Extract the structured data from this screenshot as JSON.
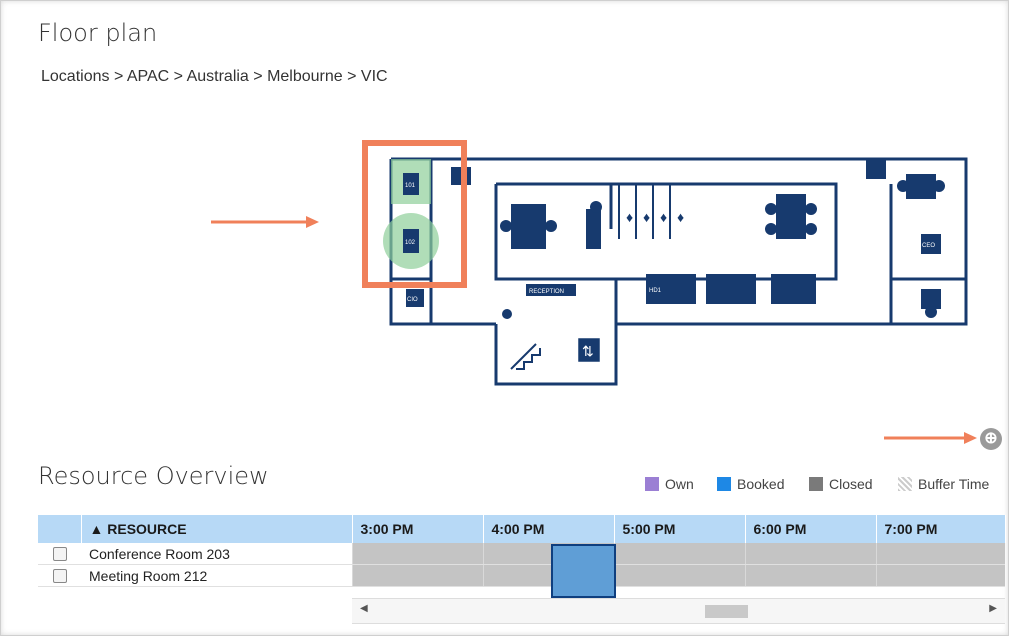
{
  "page": {
    "title": "Floor plan",
    "breadcrumb": "Locations > APAC > Australia > Melbourne > VIC"
  },
  "floorplan": {
    "labels": {
      "desk1": "101",
      "desk2": "102",
      "cio": "CIO",
      "ceo": "CEO",
      "reception": "RECEPTION",
      "hd1": "HD1"
    }
  },
  "resource_overview": {
    "title": "Resource Overview",
    "legend": [
      {
        "label": "Own",
        "color": "#9b7fd4"
      },
      {
        "label": "Booked",
        "color": "#1e88e5"
      },
      {
        "label": "Closed",
        "color": "#7a7a7a"
      },
      {
        "label": "Buffer Time",
        "color": "#cccccc"
      }
    ],
    "columns": {
      "resource": "▲ RESOURCE",
      "times": [
        "3:00 PM",
        "4:00 PM",
        "5:00 PM",
        "6:00 PM",
        "7:00 PM"
      ]
    },
    "rows": [
      {
        "name": "Conference Room 203"
      },
      {
        "name": "Meeting Room 212"
      }
    ]
  },
  "colors": {
    "accent_orange": "#f0805a",
    "header_blue": "#b7d9f6",
    "plan_navy": "#173a6e",
    "selected_green": "#8fcf9a"
  }
}
